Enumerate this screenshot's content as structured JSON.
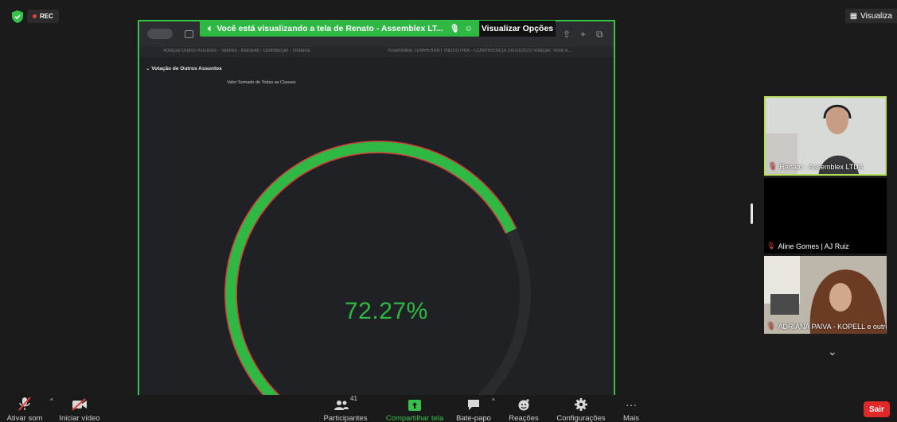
{
  "top": {
    "rec_label": "REC",
    "view_label": "Visualiza"
  },
  "share": {
    "banner_text": "Você está visualizando a tela de  Renato - Assemblex LT...",
    "options_label": "Visualizar Opções",
    "tab1": "Votação Outros Assuntos - Valores - Maravell - Distribuição - Grafana",
    "tab2": "Assembleia TEMPERART INDÚSTRIA - CONVIVÊNCIA 16/10/2023 Votação: Você A...",
    "section_title": "Votação de Outros Assuntos",
    "sub_title": "Valor Somado de Todas as Classes",
    "gauge_value": 72.27,
    "gauge_label": "72.27%",
    "colors": {
      "green": "#2fb944",
      "red": "#d6393a",
      "track": "#2a2b2e"
    }
  },
  "participants": [
    {
      "name": "Renato - Assemblex LTDA"
    },
    {
      "name": "Aline Gomes | AJ Ruiz"
    },
    {
      "name": "ADRIANA PAIVA - KOPELL e outros"
    }
  ],
  "toolbar": {
    "mute": "Ativar som",
    "video": "Iniciar vídeo",
    "participants": "Participantes",
    "participants_count": "41",
    "share": "Compartilhar tela",
    "chat": "Bate-papo",
    "reactions": "Reações",
    "settings": "Configurações",
    "more": "Mais",
    "leave": "Sair"
  }
}
